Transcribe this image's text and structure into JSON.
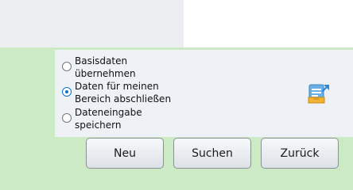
{
  "options": [
    {
      "label": "Basisdaten\nübernehmen",
      "checked": false
    },
    {
      "label": "Daten für meinen\nBereich abschließen",
      "checked": true
    },
    {
      "label": "Dateneingabe\nspeichern",
      "checked": false
    }
  ],
  "icons": {
    "document": "document-edit-icon"
  },
  "buttons": {
    "neu": "Neu",
    "suchen": "Suchen",
    "zurueck": "Zurück"
  },
  "colors": {
    "background": "#ccebc4",
    "panel": "#eef2f6",
    "radio_accent": "#0a6fd6"
  }
}
